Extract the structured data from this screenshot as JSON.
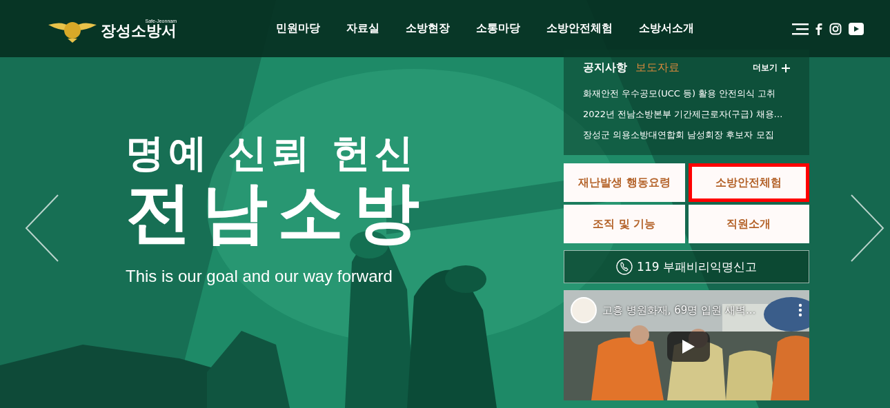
{
  "header": {
    "logo": {
      "subtitle": "Safe-Jeonnam",
      "title": "장성소방서"
    },
    "nav": [
      {
        "label": "민원마당"
      },
      {
        "label": "자료실"
      },
      {
        "label": "소방현장"
      },
      {
        "label": "소통마당"
      },
      {
        "label": "소방안전체험"
      },
      {
        "label": "소방서소개"
      }
    ]
  },
  "hero": {
    "slogan": "명예 신뢰 헌신",
    "title": "전남소방",
    "tagline": "This is our goal and our way forward"
  },
  "notice": {
    "tabs": [
      {
        "label": "공지사항",
        "selected": true
      },
      {
        "label": "보도자료",
        "selected": false
      }
    ],
    "more": "더보기",
    "items": [
      "화재안전 우수공모(UCC 등) 활용 안전의식 고취",
      "2022년 전남소방본부 기간제근로자(구급) 채용…",
      "장성군 의용소방대연합회 남성회장 후보자 모집"
    ]
  },
  "quick_links": [
    {
      "label": "재난발생 행동요령",
      "highlighted": false
    },
    {
      "label": "소방안전체험",
      "highlighted": true
    },
    {
      "label": "조직 및 기능",
      "highlighted": false
    },
    {
      "label": "직원소개",
      "highlighted": false
    }
  ],
  "report_button": {
    "label": "119 부패비리익명신고"
  },
  "video": {
    "title": "고흥 병원화재, 69명 입원 새벽..."
  }
}
